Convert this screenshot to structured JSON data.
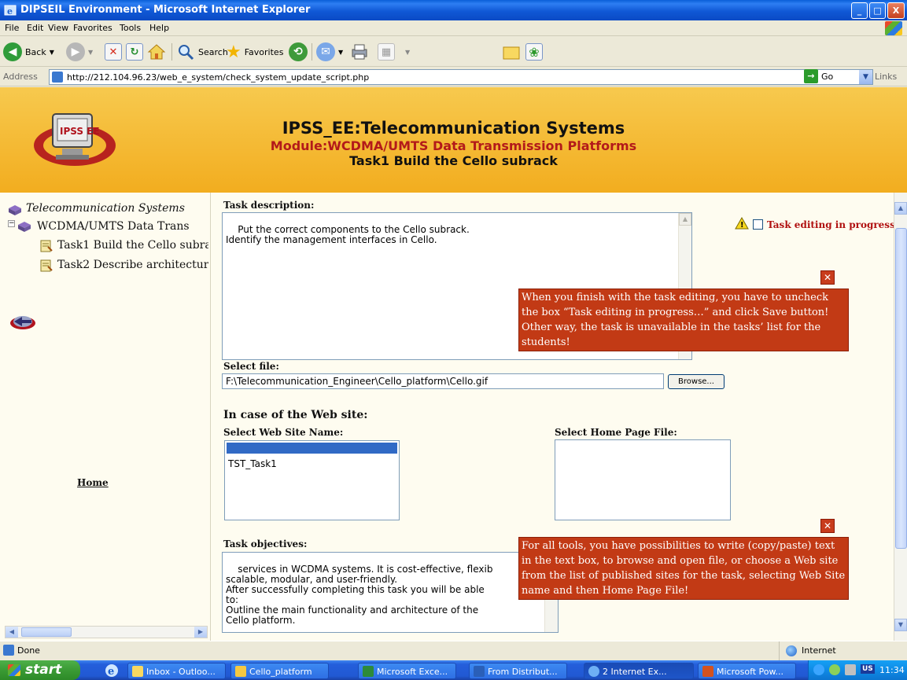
{
  "window": {
    "title": "DIPSEIL Environment - Microsoft Internet Explorer",
    "controls": {
      "minimize": "_",
      "maximize": "□",
      "close": "X"
    }
  },
  "menu": {
    "items": [
      "File",
      "Edit",
      "View",
      "Favorites",
      "Tools",
      "Help"
    ]
  },
  "toolbar": {
    "back_label": "Back",
    "search_label": "Search",
    "favorites_label": "Favorites"
  },
  "address": {
    "label": "Address",
    "url": "http://212.104.96.23/web_e_system/check_system_update_script.php",
    "go_label": "Go",
    "links_label": "Links"
  },
  "header": {
    "logo_text": "IPSS EE",
    "title": "IPSS_EE:Telecommunication Systems",
    "module": "Module:WCDMA/UMTS Data Transmission Platforms",
    "task": "Task1 Build the Cello subrack",
    "colors": {
      "background": "#f4b732",
      "module_text": "#b31a1a"
    }
  },
  "sidebar": {
    "root": "Telecommunication Systems",
    "module": "WCDMA/UMTS Data Trans",
    "tasks": [
      "Task1 Build the Cello subra",
      "Task2 Describe architecture"
    ],
    "home_label": "Home"
  },
  "main": {
    "task_description_label": "Task description:",
    "task_description_text": "Put the correct components to the Cello subrack.\nIdentify the management interfaces in Cello.",
    "editing_checkbox_label": "Task editing in progress...",
    "editing_checked": false,
    "tip1": "When you finish with the task editing, you have to uncheck the box “Task editing in progress…” and click Save button! Other way, the task is unavailable in the tasks’ list for the students!",
    "select_file_label": "Select file:",
    "file_path": "F:\\Telecommunication_Engineer\\Cello_platform\\Cello.gif",
    "browse_label": "Browse...",
    "web_site_heading": "In case of the Web site:",
    "web_site_name_label": "Select Web Site Name:",
    "web_site_options": [
      "TST_Task1"
    ],
    "home_page_file_label": "Select Home Page File:",
    "task_objectives_label": "Task objectives:",
    "task_objectives_text": "services in WCDMA systems. It is cost-effective, flexib\nscalable, modular, and user-friendly.\nAfter successfully completing this task you will be able\nto:\nOutline the main functionality and architecture of the\nCello platform.",
    "tip2": "For all tools, you have possibilities to write (copy/paste) text in the text box, to browse and open file, or choose a Web site from the list of published sites for the task, selecting Web Site name and then Home Page File!",
    "tip_color": "#c23a15"
  },
  "status": {
    "text": "Done",
    "zone": "Internet"
  },
  "taskbar": {
    "start_label": "start",
    "tasks": [
      "Inbox - Outloo...",
      "Cello_platform",
      "Microsoft Exce...",
      "From Distribut...",
      "2 Internet Ex...",
      "Microsoft Pow..."
    ],
    "language": "US",
    "clock": "11:34"
  }
}
